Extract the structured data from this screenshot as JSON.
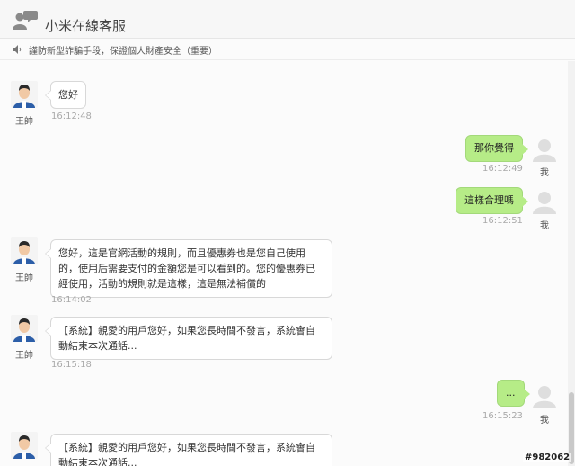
{
  "header": {
    "title": "小米在線客服",
    "logo_icon": "chat-people-icon"
  },
  "notice": {
    "icon": "speaker-icon",
    "text": "謹防新型詐騙手段，保證個人財產安全（重要）"
  },
  "agent": {
    "name": "王帥"
  },
  "me": {
    "label": "我"
  },
  "messages": [
    {
      "side": "left",
      "text": "您好",
      "time": "16:12:48"
    },
    {
      "side": "right",
      "text": "那你覺得",
      "time": "16:12:49"
    },
    {
      "side": "right",
      "text": "這樣合理嗎",
      "time": "16:12:51"
    },
    {
      "side": "left",
      "text": "您好，這是官網活動的規則，而且優惠券也是您自己使用的，使用后需要支付的金額您是可以看到的。您的優惠券已經使用，活動的規則就是這樣，這是無法補償的",
      "time": "16:14:02"
    },
    {
      "side": "left",
      "text": "【系統】親愛的用戶您好，如果您長時間不發言，系統會自動結束本次通話...",
      "time": "16:15:18"
    },
    {
      "side": "right",
      "text": "...",
      "time": "16:15:23"
    },
    {
      "side": "left",
      "text": "【系統】親愛的用戶您好，如果您長時間不發言，系統會自動結束本次通話...",
      "time": ""
    }
  ],
  "watermark": "#982062"
}
